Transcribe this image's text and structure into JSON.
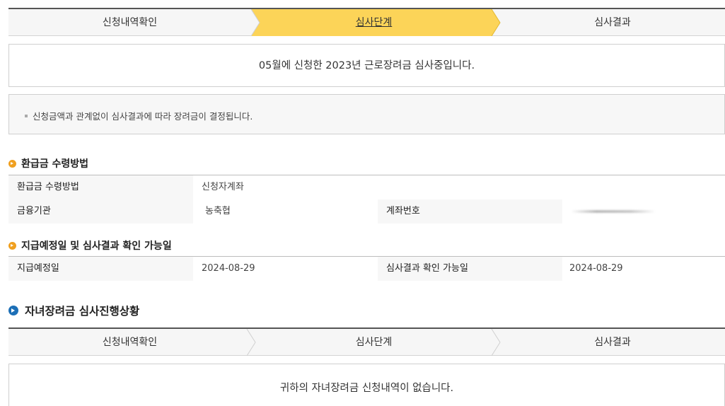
{
  "top_steps": {
    "step1": "신청내역확인",
    "step2": "심사단계",
    "step3": "심사결과",
    "active_color": "#fcd458"
  },
  "status_message": "05월에 신청한 2023년 근로장려금 심사중입니다.",
  "notice": "신청금액과 관계없이 심사결과에 따라 장려금이 결정됩니다.",
  "refund_section": {
    "title": "환급금 수령방법",
    "method_label": "환급금 수령방법",
    "method_value": "신청자계좌",
    "bank_label": "금융기관",
    "bank_value": "농축협",
    "account_label": "계좌번호"
  },
  "schedule_section": {
    "title": "지급예정일 및 심사결과 확인 가능일",
    "pay_date_label": "지급예정일",
    "pay_date_value": "2024-08-29",
    "result_date_label": "심사결과 확인 가능일",
    "result_date_value": "2024-08-29"
  },
  "child_section": {
    "title": "자녀장려금 심사진행상황",
    "step1": "신청내역확인",
    "step2": "심사단계",
    "step3": "심사결과",
    "message": "귀하의 자녀장려금 신청내역이 없습니다."
  }
}
